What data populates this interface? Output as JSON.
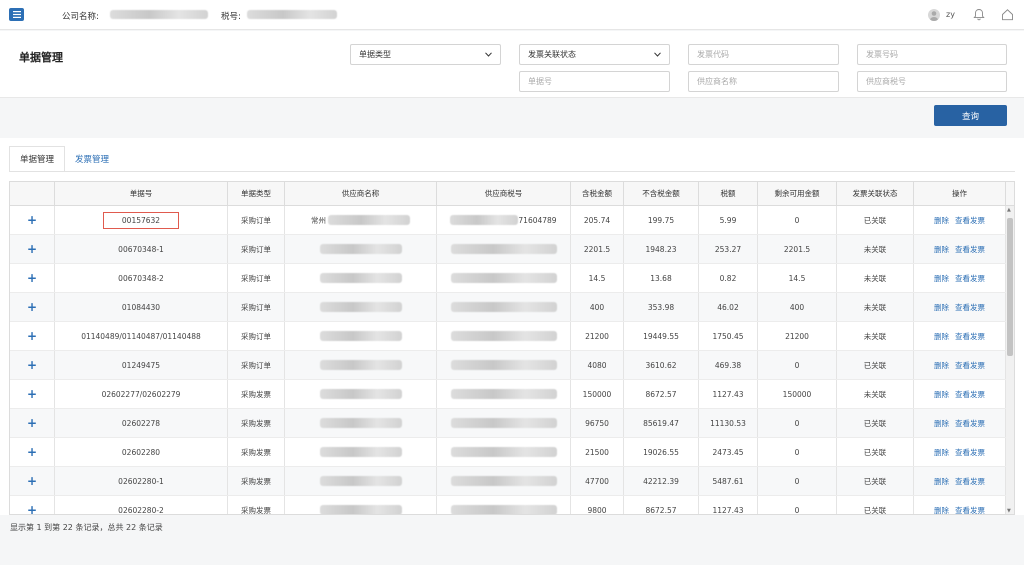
{
  "topbar": {
    "company_label": "公司名称:",
    "tax_label": "税号:",
    "username": "zy",
    "icons": [
      "menu-icon",
      "user-avatar",
      "bell-icon",
      "home-icon"
    ]
  },
  "page_title": "单据管理",
  "filters": {
    "doc_type": "单据类型",
    "invoice_status": "发票关联状态",
    "invoice_code_ph": "发票代码",
    "invoice_no_ph": "发票号码",
    "doc_no_ph": "单据号",
    "supplier_name_ph": "供应商名称",
    "supplier_tax_ph": "供应商税号"
  },
  "query_label": "查询",
  "tabs": [
    "单据管理",
    "发票管理"
  ],
  "table": {
    "columns": [
      "单据号",
      "单据类型",
      "供应商名称",
      "供应商税号",
      "含税金额",
      "不含税金额",
      "税额",
      "剩余可用金额",
      "发票关联状态",
      "操作"
    ],
    "actions": [
      "删除",
      "查看发票"
    ],
    "rows": [
      {
        "no": "00157632",
        "type": "采购订单",
        "supplier_prefix": "常州",
        "tax_suffix": "71604789",
        "gross": "205.74",
        "net": "199.75",
        "tax": "5.99",
        "remain": "0",
        "status": "已关联"
      },
      {
        "no": "00670348-1",
        "type": "采购订单",
        "supplier_prefix": "",
        "tax_suffix": "",
        "gross": "2201.5",
        "net": "1948.23",
        "tax": "253.27",
        "remain": "2201.5",
        "status": "未关联"
      },
      {
        "no": "00670348-2",
        "type": "采购订单",
        "supplier_prefix": "",
        "tax_suffix": "",
        "gross": "14.5",
        "net": "13.68",
        "tax": "0.82",
        "remain": "14.5",
        "status": "未关联"
      },
      {
        "no": "01084430",
        "type": "采购订单",
        "supplier_prefix": "",
        "tax_suffix": "",
        "gross": "400",
        "net": "353.98",
        "tax": "46.02",
        "remain": "400",
        "status": "未关联"
      },
      {
        "no": "01140489/01140487/01140488",
        "type": "采购订单",
        "supplier_prefix": "",
        "tax_suffix": "",
        "gross": "21200",
        "net": "19449.55",
        "tax": "1750.45",
        "remain": "21200",
        "status": "未关联"
      },
      {
        "no": "01249475",
        "type": "采购订单",
        "supplier_prefix": "",
        "tax_suffix": "",
        "gross": "4080",
        "net": "3610.62",
        "tax": "469.38",
        "remain": "0",
        "status": "已关联"
      },
      {
        "no": "02602277/02602279",
        "type": "采购发票",
        "supplier_prefix": "",
        "tax_suffix": "",
        "gross": "150000",
        "net": "8672.57",
        "tax": "1127.43",
        "remain": "150000",
        "status": "未关联"
      },
      {
        "no": "02602278",
        "type": "采购发票",
        "supplier_prefix": "",
        "tax_suffix": "",
        "gross": "96750",
        "net": "85619.47",
        "tax": "11130.53",
        "remain": "0",
        "status": "已关联"
      },
      {
        "no": "02602280",
        "type": "采购发票",
        "supplier_prefix": "",
        "tax_suffix": "",
        "gross": "21500",
        "net": "19026.55",
        "tax": "2473.45",
        "remain": "0",
        "status": "已关联"
      },
      {
        "no": "02602280-1",
        "type": "采购发票",
        "supplier_prefix": "",
        "tax_suffix": "",
        "gross": "47700",
        "net": "42212.39",
        "tax": "5487.61",
        "remain": "0",
        "status": "已关联"
      },
      {
        "no": "02602280-2",
        "type": "采购发票",
        "supplier_prefix": "",
        "tax_suffix": "",
        "gross": "9800",
        "net": "8672.57",
        "tax": "1127.43",
        "remain": "0",
        "status": "已关联"
      }
    ]
  },
  "footer": "显示第 1 到第 22 条记录，总共 22 条记录",
  "colors": {
    "primary": "#2862a3",
    "link": "#2c6fb5",
    "highlight": "#e05a4e"
  }
}
